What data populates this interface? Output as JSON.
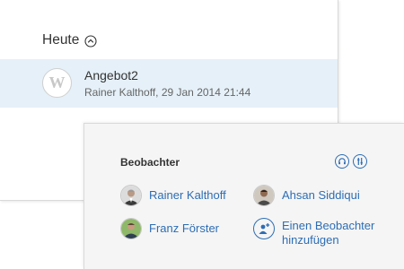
{
  "activity": {
    "section_title": "Heute",
    "item": {
      "avatar_letter": "W",
      "title": "Angebot2",
      "meta": "Rainer Kalthoff, 29 Jan 2014 21:44"
    }
  },
  "observers": {
    "heading": "Beobachter",
    "people": [
      {
        "name": "Rainer Kalthoff",
        "avatar": "person-photo-icon"
      },
      {
        "name": "Ahsan Siddiqui",
        "avatar": "person-photo-icon"
      },
      {
        "name": "Franz Förster",
        "avatar": "person-photo-icon"
      }
    ],
    "add_label": "Einen Beobachter hinzufügen",
    "tools": [
      "headset-icon",
      "settings-icon"
    ]
  },
  "colors": {
    "link": "#2d6db4",
    "highlight_row": "#e5f0f8",
    "card_background": "#f5f5f5"
  }
}
